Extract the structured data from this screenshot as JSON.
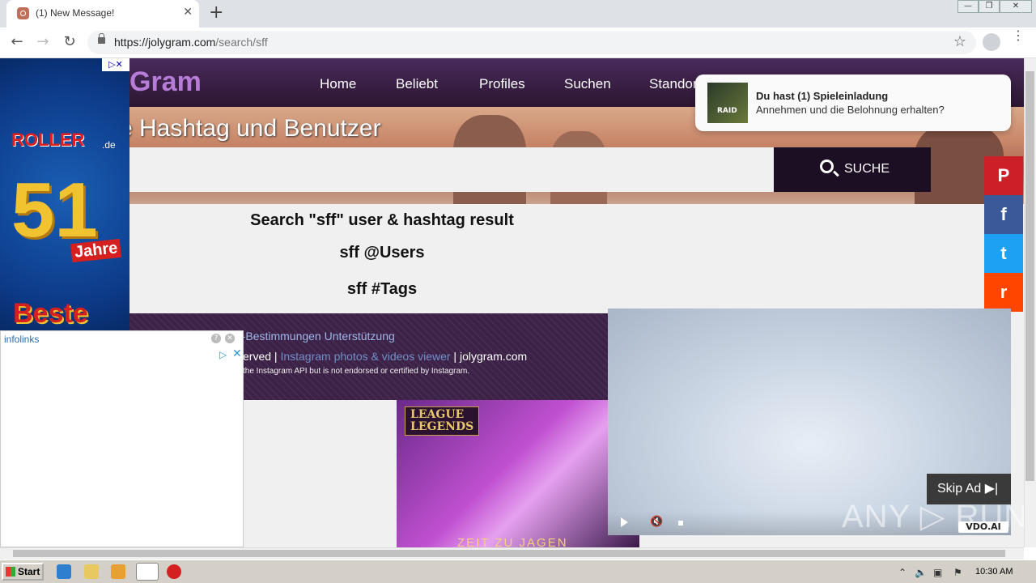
{
  "browser": {
    "tab_title": "(1) New Message!",
    "new_tab": "+",
    "close_tab": "✕",
    "url_host": "https://jolygram.com",
    "url_path": "/search/sff",
    "star": "☆",
    "menu": "⋮",
    "win_min": "—",
    "win_max": "❐",
    "win_close": "✕"
  },
  "site": {
    "logo": "Gram",
    "nav": [
      "Home",
      "Beliebt",
      "Profiles",
      "Suchen",
      "Standort"
    ],
    "hero_title": "e Hashtag und Benutzer",
    "search_button": "SUCHE",
    "result_title": "Search \"sff\" user & hashtag result",
    "users_heading": "sff @Users",
    "tags_heading": "sff #Tags",
    "footer_links": "utz-Bestimmungen   Unterstützung",
    "footer_rights": "erved | ",
    "footer_viewer": "Instagram photos & videos viewer",
    "footer_domain": " | jolygram.com",
    "footer_disclaimer": "the Instagram API but is not endorsed or certified by Instagram."
  },
  "social": [
    "P",
    "f",
    "t",
    "r"
  ],
  "social_colors": [
    "#cb2027",
    "#3b5998",
    "#1da1f2",
    "#ff4500"
  ],
  "left_ad": {
    "brand": "ROLLER",
    "brand_suffix": ".de",
    "number": "51",
    "jahre": "Jahre",
    "beste": "Beste",
    "adchoice": "▷✕"
  },
  "infolinks": {
    "logo": "infolinks",
    "help": "?",
    "close": "✕",
    "arrow": "▷",
    "x": "✕"
  },
  "lol_ad": {
    "brand": "LEAGUE\nLEGENDS",
    "tagline": "ZEIT ZU JAGEN"
  },
  "notification": {
    "title": "Du hast (1) Spieleinladung",
    "body": "Annehmen und die Belohnung erhalten?",
    "image_label": "RAID"
  },
  "video_ad": {
    "skip": "Skip Ad ▶|",
    "brand": "VDO.AI",
    "mute": "🔇"
  },
  "watermark": "ANY ▷ RUN",
  "taskbar": {
    "start": "Start",
    "time": "10:30 AM"
  }
}
